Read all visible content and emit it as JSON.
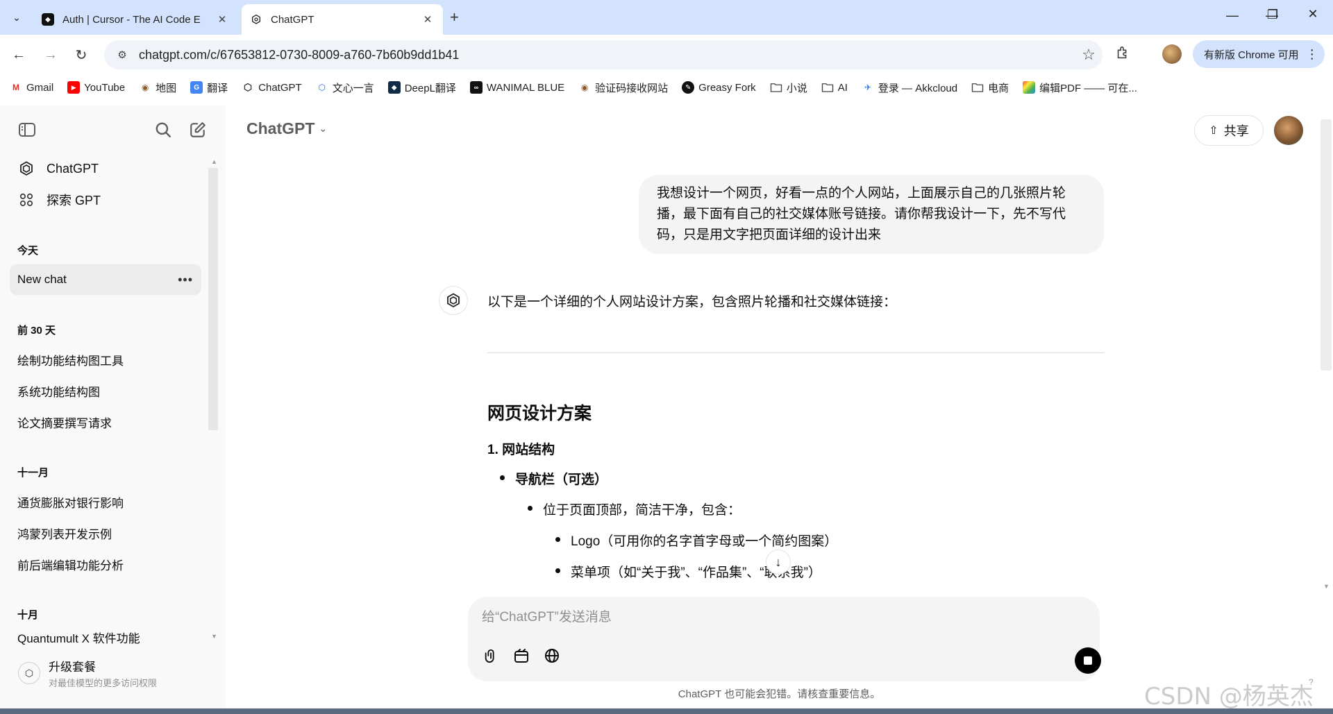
{
  "browser": {
    "tabs": [
      {
        "title": "Auth | Cursor - The AI Code E",
        "active": false
      },
      {
        "title": "ChatGPT",
        "active": true
      }
    ],
    "url": "chatgpt.com/c/67653812-0730-8009-a760-7b60b9dd1b41",
    "update_label": "有新版 Chrome 可用",
    "bookmarks": [
      "Gmail",
      "YouTube",
      "地图",
      "翻译",
      "ChatGPT",
      "文心一言",
      "DeepL翻译",
      "WANIMAL BLUE",
      "验证码接收网站",
      "Greasy Fork",
      "小说",
      "AI",
      "登录 — Akkcloud",
      "电商",
      "编辑PDF —— 可在..."
    ]
  },
  "sidebar": {
    "top_items": [
      {
        "label": "ChatGPT",
        "icon": "openai-logo-icon"
      },
      {
        "label": "探索 GPT",
        "icon": "grid-icon"
      }
    ],
    "sections": [
      {
        "title": "今天",
        "chats": [
          "New chat"
        ]
      },
      {
        "title": "前 30 天",
        "chats": [
          "绘制功能结构图工具",
          "系统功能结构图",
          "论文摘要撰写请求"
        ]
      },
      {
        "title": "十一月",
        "chats": [
          "通货膨胀对银行影响",
          "鸿蒙列表开发示例",
          "前后端编辑功能分析"
        ]
      },
      {
        "title": "十月",
        "chats": [
          "Quantumult X 软件功能"
        ]
      }
    ],
    "upgrade": {
      "title": "升级套餐",
      "subtitle": "对最佳模型的更多访问权限"
    }
  },
  "header": {
    "model": "ChatGPT",
    "share_label": "共享"
  },
  "conversation": {
    "user_message": "我想设计一个网页，好看一点的个人网站，上面展示自己的几张照片轮播，最下面有自己的社交媒体账号链接。请你帮我设计一下，先不写代码，只是用文字把页面详细的设计出来",
    "assistant_intro": "以下是一个详细的个人网站设计方案，包含照片轮播和社交媒体链接：",
    "heading": "网页设计方案",
    "section_title": "1. 网站结构",
    "items": [
      "导航栏（可选）",
      "位于页面顶部，简洁干净，包含：",
      "Logo（可用你的名字首字母或一个简约图案）",
      "菜单项（如“关于我”、“作品集”、“联系我”）"
    ]
  },
  "composer": {
    "placeholder": "给“ChatGPT”发送消息"
  },
  "disclaimer": "ChatGPT 也可能会犯错。请核查重要信息。",
  "watermark": "CSDN @杨英杰"
}
